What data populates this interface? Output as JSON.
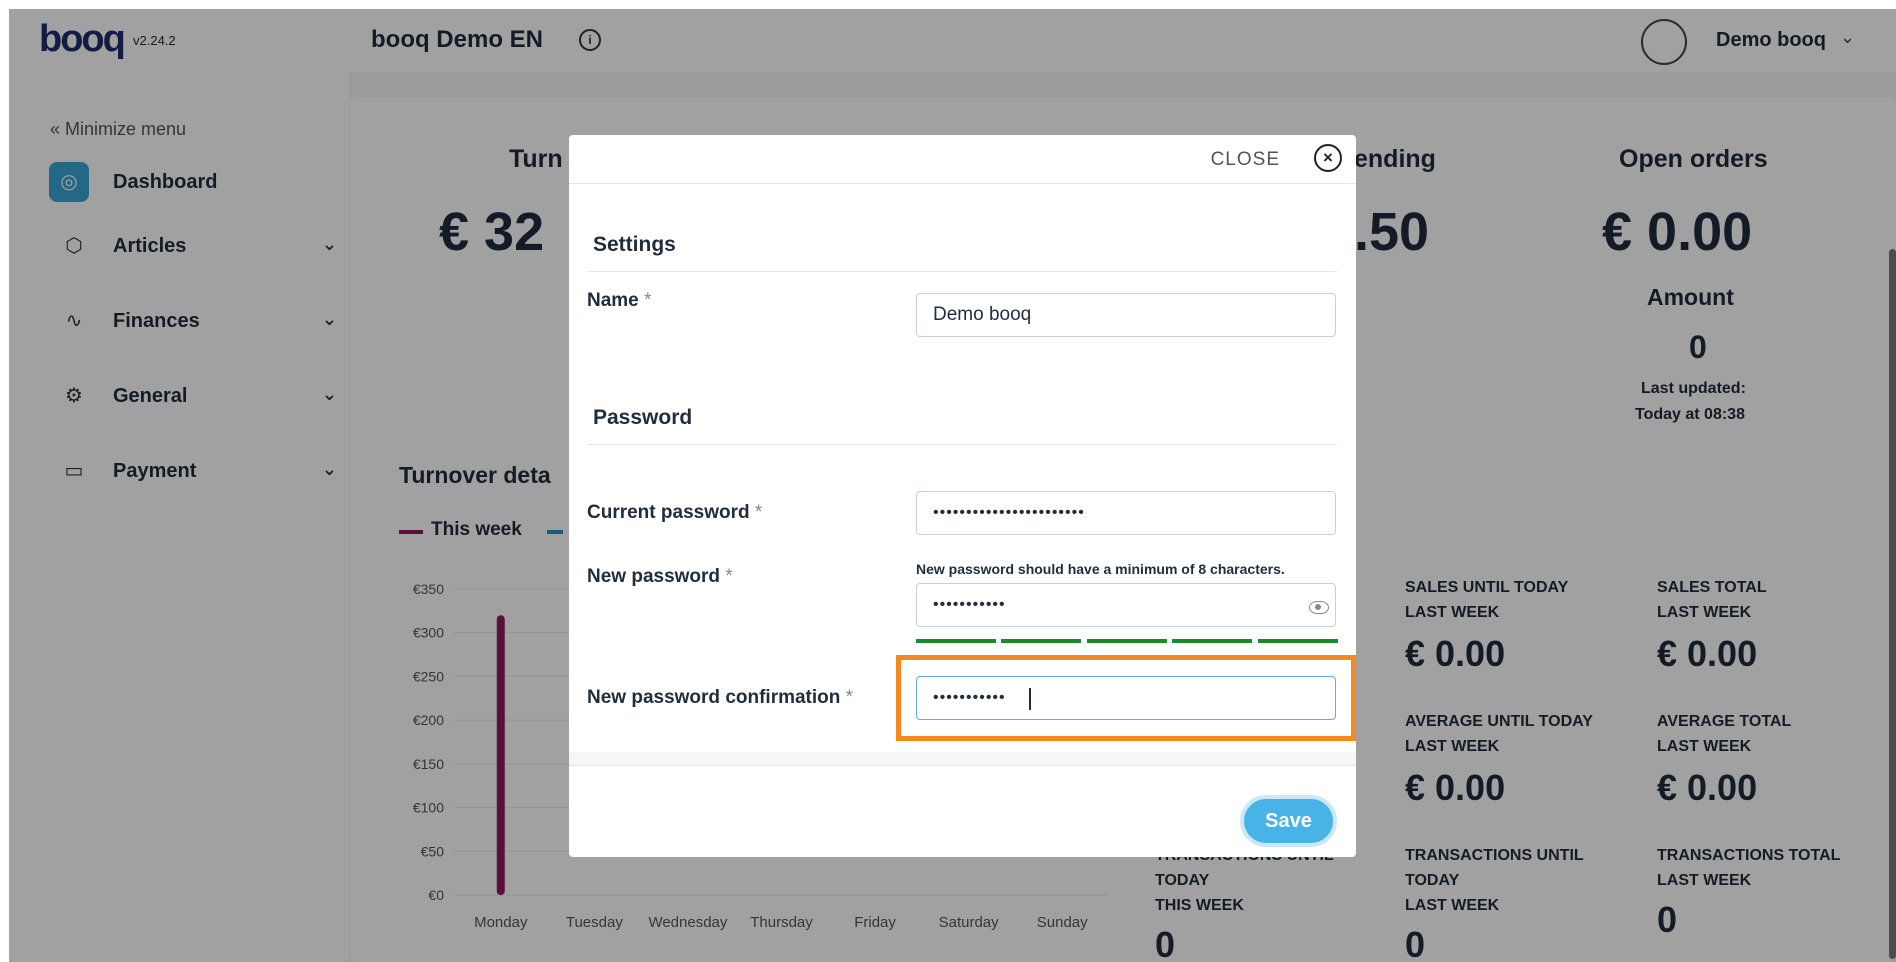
{
  "header": {
    "logo": "booq",
    "version": "v2.24.2",
    "venue": "booq Demo EN",
    "user": "Demo booq"
  },
  "sidebar": {
    "minimize": "« Minimize menu",
    "items": [
      {
        "label": "Dashboard",
        "icon": "compass-icon",
        "active": true
      },
      {
        "label": "Articles",
        "icon": "box-icon"
      },
      {
        "label": "Finances",
        "icon": "pulse-icon"
      },
      {
        "label": "General",
        "icon": "gear-icon"
      },
      {
        "label": "Payment",
        "icon": "card-icon"
      }
    ]
  },
  "dashboard": {
    "turnover_title": "Turn",
    "turnover_value": "€ 32",
    "pending_title": "ending",
    "pending_value": ".50",
    "open_orders_title": "Open orders",
    "open_orders_value": "€ 0.00",
    "amount_title": "Amount",
    "amount_value": "0",
    "last_updated_label": "Last updated:",
    "last_updated_value": "Today at 08:38",
    "turnover_details": "Turnover deta",
    "legend_this_week": "This week",
    "tiles": [
      {
        "label_1": "SALES UNTIL TODAY",
        "label_2": "LAST WEEK",
        "value": "€ 0.00"
      },
      {
        "label_1": "SALES TOTAL",
        "label_2": "LAST WEEK",
        "value": "€ 0.00"
      },
      {
        "label_1": "AVERAGE UNTIL TODAY",
        "label_2": "LAST WEEK",
        "value": "€ 0.00"
      },
      {
        "label_1": "AVERAGE TOTAL",
        "label_2": "LAST WEEK",
        "value": "€ 0.00"
      },
      {
        "label_1": "TRANSACTIONS UNTIL",
        "label_2": "TODAY",
        "label_3": "THIS WEEK",
        "value": "0"
      },
      {
        "label_1": "TRANSACTIONS UNTIL",
        "label_2": "TODAY",
        "label_3": "LAST WEEK",
        "value": "0"
      },
      {
        "label_1": "TRANSACTIONS TOTAL",
        "label_2": "LAST WEEK",
        "value": "0"
      }
    ]
  },
  "chart_data": {
    "type": "bar",
    "categories": [
      "Monday",
      "Tuesday",
      "Wednesday",
      "Thursday",
      "Friday",
      "Saturday",
      "Sunday"
    ],
    "series": [
      {
        "name": "This week",
        "color": "#8b1a5c",
        "values": [
          320,
          0,
          0,
          0,
          0,
          0,
          0
        ]
      }
    ],
    "yticks": [
      "€0",
      "€50",
      "€100",
      "€150",
      "€200",
      "€250",
      "€300",
      "€350"
    ],
    "ylim": [
      0,
      350
    ]
  },
  "modal": {
    "close_label": "CLOSE",
    "settings_title": "Settings",
    "name_label": "Name",
    "name_value": "Demo booq",
    "password_title": "Password",
    "current_password_label": "Current password",
    "current_password_value": "•••••••••••••••••••••••",
    "new_password_label": "New password",
    "new_password_hint": "New password should have a minimum of 8 characters.",
    "new_password_value": "•••••••••••",
    "confirm_label": "New password confirmation",
    "confirm_value": "•••••••••••",
    "required_mark": "*",
    "save_label": "Save"
  }
}
